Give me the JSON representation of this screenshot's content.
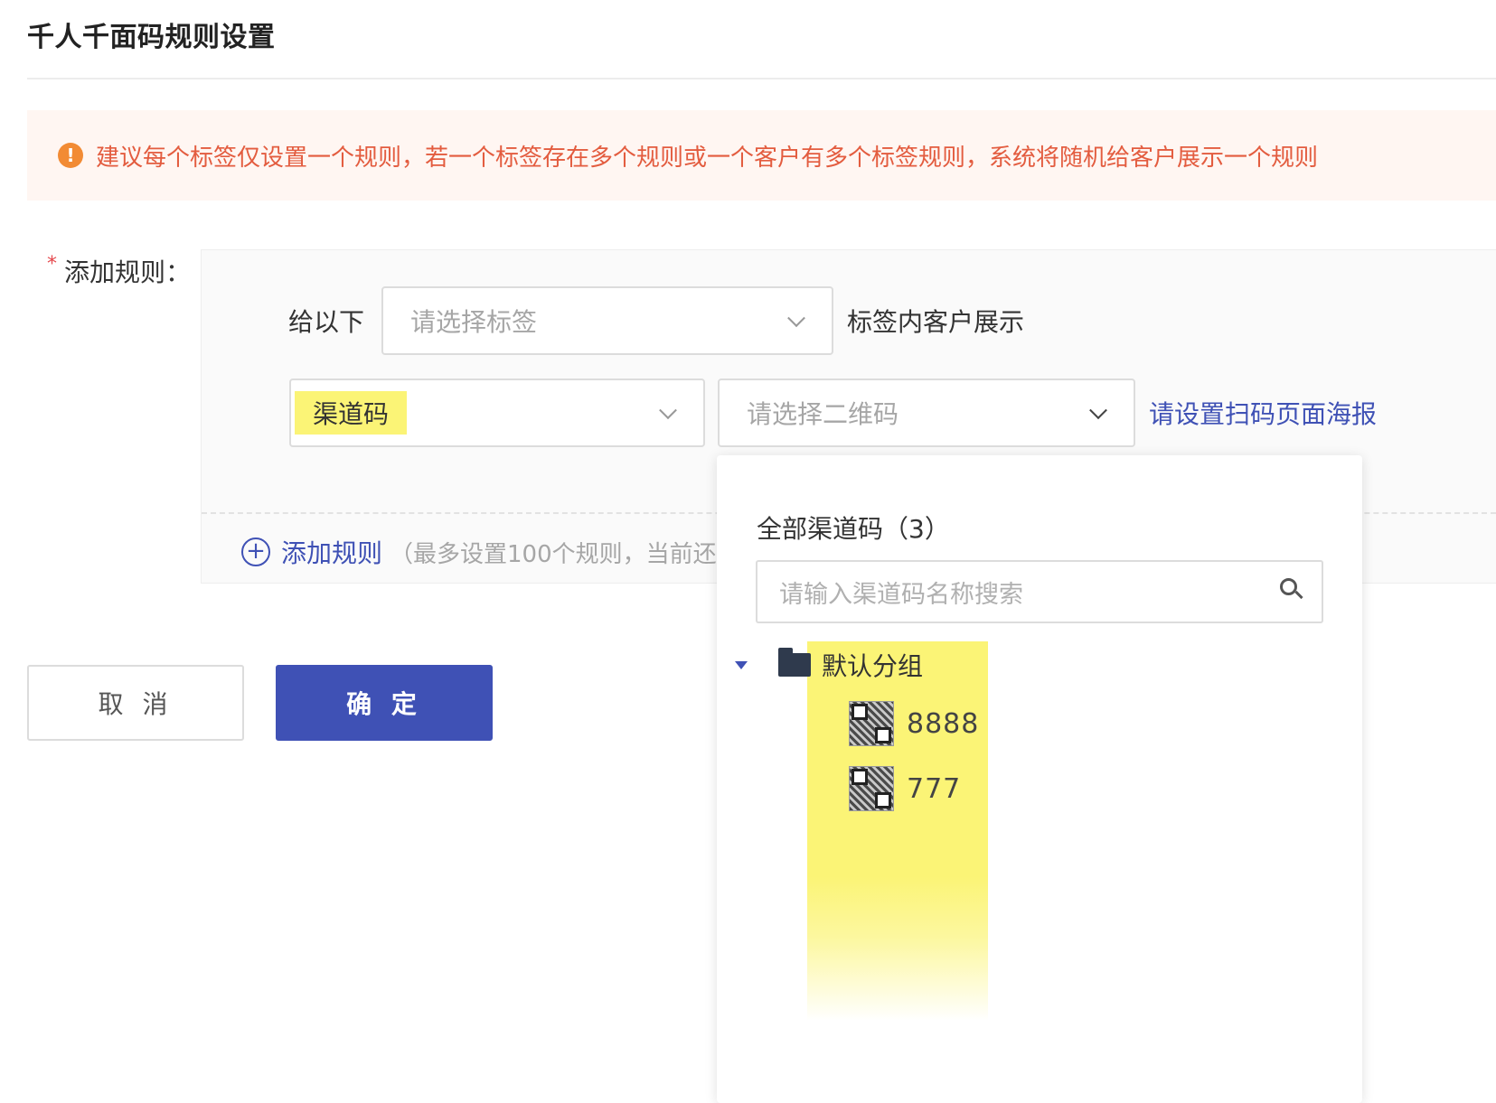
{
  "page": {
    "title": "千人千面码规则设置"
  },
  "notice": {
    "icon": "exclamation-icon",
    "text": "建议每个标签仅设置一个规则，若一个标签存在多个规则或一个客户有多个标签规则，系统将随机给客户展示一个规则"
  },
  "form": {
    "required_mark": "*",
    "add_rule_label": "添加规则："
  },
  "rule": {
    "prefix": "给以下",
    "tag_select_placeholder": "请选择标签",
    "suffix": "标签内客户展示",
    "type_select_value": "渠道码",
    "qr_select_placeholder": "请选择二维码",
    "poster_link": "请设置扫码页面海报"
  },
  "add_rule": {
    "label": "添加规则",
    "hint": "（最多设置100个规则，当前还"
  },
  "buttons": {
    "cancel": "取 消",
    "confirm": "确 定"
  },
  "dropdown": {
    "title": "全部渠道码（3）",
    "search_placeholder": "请输入渠道码名称搜索",
    "group": {
      "label": "默认分组",
      "items": [
        {
          "label": "8888"
        },
        {
          "label": "777"
        }
      ]
    }
  },
  "colors": {
    "primary": "#3f51b5",
    "warning_text": "#e35c3f",
    "warning_bg": "#fff6f2",
    "highlight": "#fbf476"
  }
}
